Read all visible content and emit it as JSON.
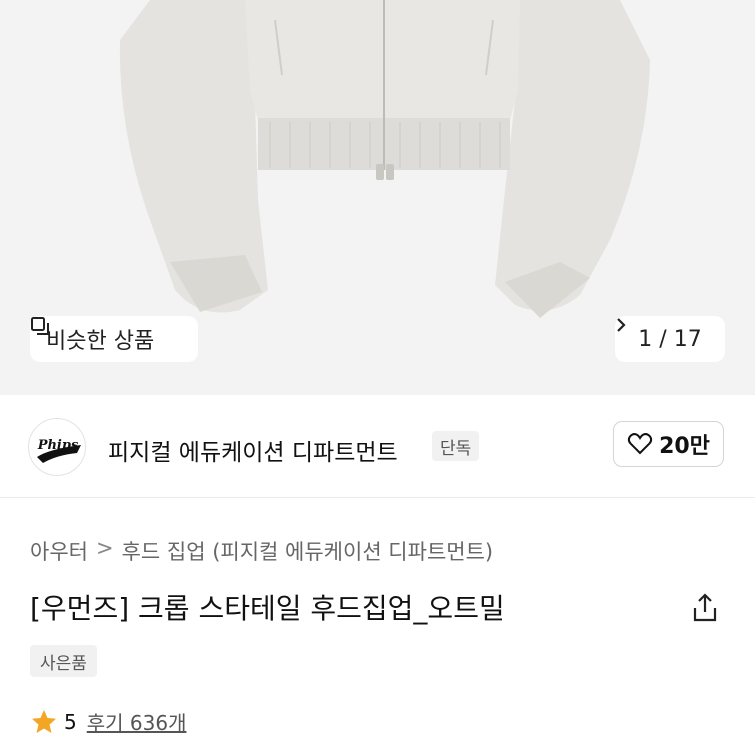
{
  "gallery": {
    "similar_label": "비슷한 상품",
    "counter": "1 / 17",
    "next_icon": "chevron-right-icon",
    "similar_icon": "copy-icon"
  },
  "brand": {
    "logo_text": "Phips",
    "name": "피지컬 에듀케이션 디파트먼트",
    "exclusive_badge": "단독",
    "like_count": "20만",
    "like_icon": "heart-outline-icon"
  },
  "breadcrumb": {
    "items": [
      "아우터",
      "후드 집업 (피지컬 에듀케이션 디파트먼트)"
    ],
    "separator": ">"
  },
  "product": {
    "title": "[우먼즈] 크롭 스타테일 후드집업_오트밀",
    "gift_badge": "사은품",
    "rating": "5",
    "reviews": "후기 636개",
    "star_color": "#f2a623",
    "share_icon": "share-icon"
  }
}
